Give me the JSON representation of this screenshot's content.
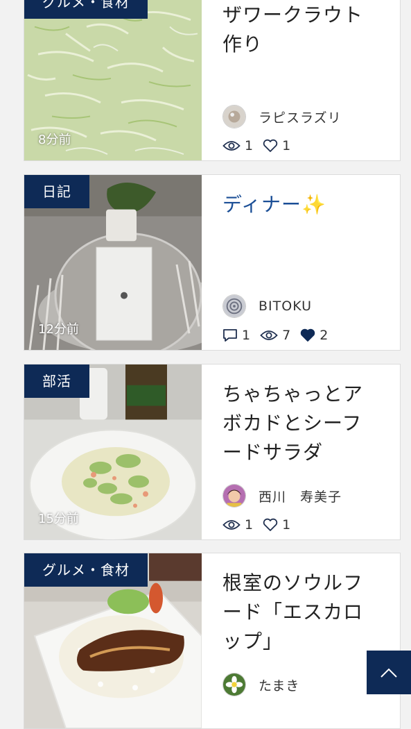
{
  "articles": [
    {
      "category": "グルメ・食材",
      "time": "8分前",
      "title": "ザワークラウト作り",
      "author": "ラピスラズリ",
      "views": "1",
      "likes": "1"
    },
    {
      "category": "日記",
      "time": "12分前",
      "title": "ディナー✨",
      "author": "BITOKU",
      "comments": "1",
      "views": "7",
      "likes": "2"
    },
    {
      "category": "部活",
      "time": "15分前",
      "title": "ちゃちゃっとアボカドとシーフードサラダ",
      "author": "西川　寿美子",
      "views": "1",
      "likes": "1"
    },
    {
      "category": "グルメ・食材",
      "title": "根室のソウルフード「エスカロップ」",
      "author": "たまき"
    }
  ],
  "colors": {
    "category_bg": "#0e2a56",
    "title_accent": "#1a4e96",
    "back_to_top_bg": "#0e2a56"
  },
  "icons": {
    "views": "eye-icon",
    "likes": "heart-outline-icon",
    "liked": "heart-filled-icon",
    "comments": "comment-icon",
    "back_to_top": "chevron-up-icon"
  }
}
